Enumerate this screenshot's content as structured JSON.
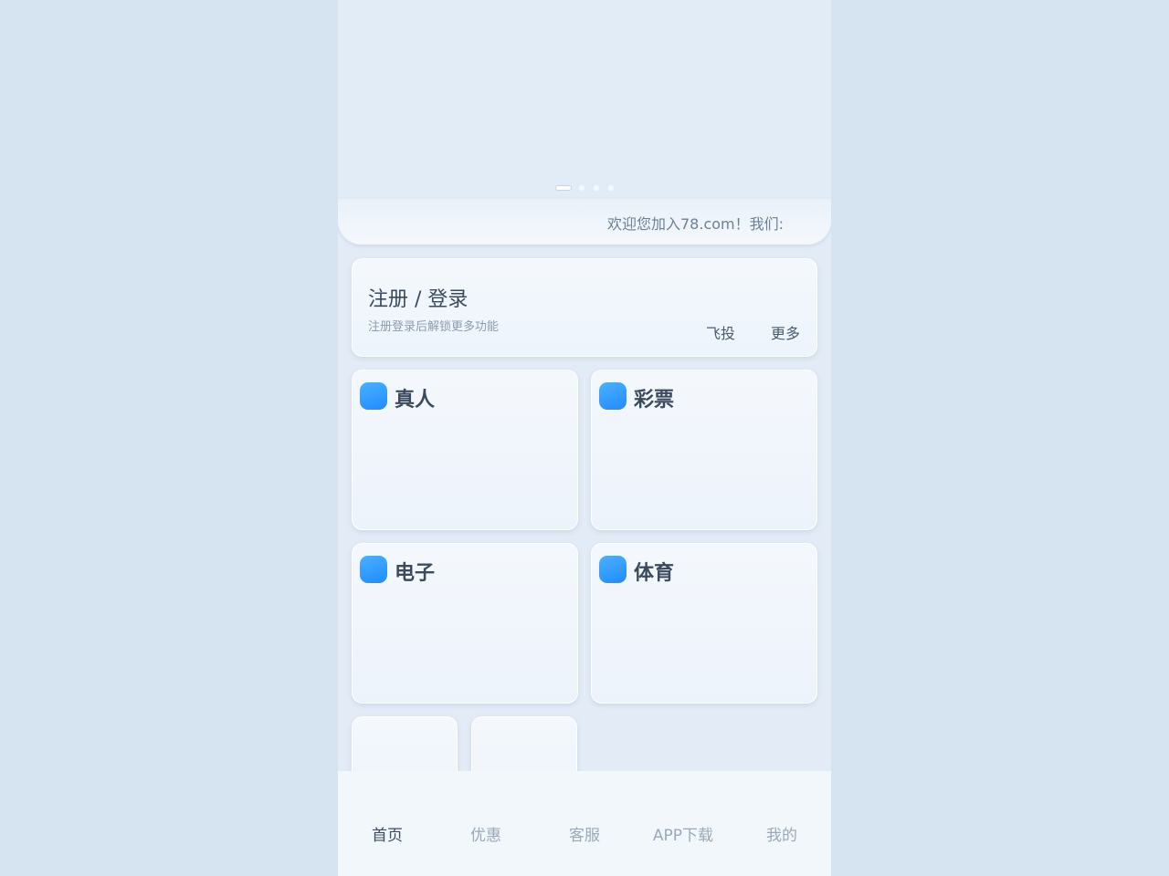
{
  "marquee": {
    "text": "欢迎您加入78.com！我们:"
  },
  "login_card": {
    "title": "注册 / 登录",
    "subtitle": "注册登录后解锁更多功能",
    "link_1": "飞投",
    "link_2": "更多"
  },
  "categories": [
    {
      "label": "真人",
      "icon": "live-casino-icon"
    },
    {
      "label": "彩票",
      "icon": "lottery-icon"
    },
    {
      "label": "电子",
      "icon": "slots-icon"
    },
    {
      "label": "体育",
      "icon": "sports-icon"
    }
  ],
  "carousel": {
    "slide_count": 4,
    "active_index": 0
  },
  "tabbar": {
    "items": [
      {
        "label": "首页",
        "active": true
      },
      {
        "label": "优惠",
        "active": false
      },
      {
        "label": "客服",
        "active": false
      },
      {
        "label": "APP下载",
        "active": false
      },
      {
        "label": "我的",
        "active": false
      }
    ]
  },
  "colors": {
    "page_background": "#d6e3f1",
    "icon_blue": "#1e8cff",
    "text_dark": "#3c4a5e",
    "text_muted": "#9aa8b8"
  }
}
